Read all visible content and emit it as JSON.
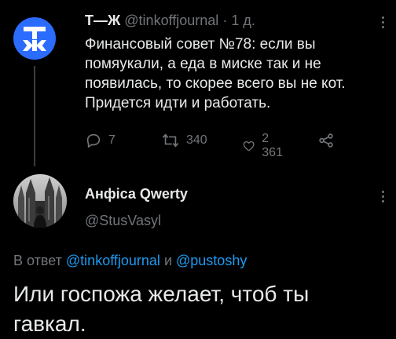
{
  "tweet": {
    "author_logo_text": "ТЖ",
    "author_name": "Т—Ж",
    "author_handle": "@tinkoffjournal",
    "separator": "·",
    "time": "1 д.",
    "text": "Финансовый совет №78: если вы помяукали, а еда в миске так и не появилась, то скорее всего вы не кот. Придется идти и работать.",
    "replies": "7",
    "retweets": "340",
    "likes": "2 361"
  },
  "reply": {
    "author_name": "Анфіса Qwerty",
    "author_handle": "@StusVasyl",
    "reply_prefix": "В ответ",
    "mention1": "@tinkoffjournal",
    "conjunction": "и",
    "mention2": "@pustoshy",
    "text": "Или госпожа желает, чтоб ты гавкал."
  },
  "colors": {
    "background": "#000000",
    "text": "#e7e9ea",
    "muted": "#71767b",
    "link": "#1d9bf0",
    "brand": "#2b6cff"
  },
  "icons": [
    "more-options-icon",
    "reply-icon",
    "retweet-icon",
    "like-icon",
    "share-icon"
  ]
}
